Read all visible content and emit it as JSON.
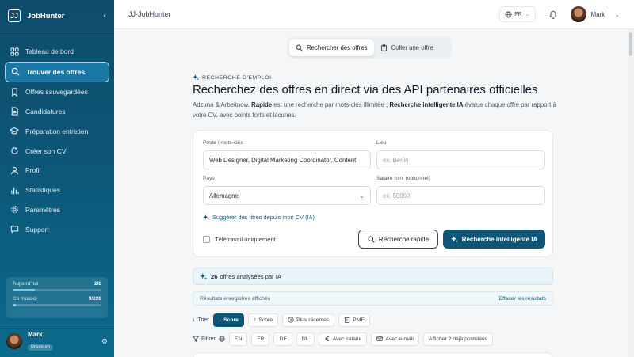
{
  "sidebar": {
    "brand": "JobHunter",
    "logo_glyph": "JJ",
    "items": [
      {
        "label": "Tableau de bord",
        "icon": "grid-icon"
      },
      {
        "label": "Trouver des offres",
        "icon": "search-icon",
        "active": true
      },
      {
        "label": "Offres sauvegardées",
        "icon": "bookmark-icon"
      },
      {
        "label": "Candidatures",
        "icon": "file-icon"
      },
      {
        "label": "Préparation entretien",
        "icon": "graduation-icon"
      },
      {
        "label": "Créer son CV",
        "icon": "refresh-icon"
      },
      {
        "label": "Profil",
        "icon": "user-icon"
      },
      {
        "label": "Statistiques",
        "icon": "bar-chart-icon"
      },
      {
        "label": "Paramètres",
        "icon": "gear-icon"
      },
      {
        "label": "Support",
        "icon": "chat-icon"
      }
    ],
    "quota": {
      "today_label": "Aujourd'hui",
      "today_value": "2/8",
      "today_fraction": 0.25,
      "month_label": "Ce mois-ci",
      "month_value": "9/220",
      "month_fraction": 0.04
    },
    "user": {
      "name": "Mark",
      "plan": "Premium"
    }
  },
  "topbar": {
    "title": "JJ-JobHunter",
    "language": "FR",
    "user_name": "Mark"
  },
  "tabs": [
    {
      "label": "Rechercher des offres",
      "active": true
    },
    {
      "label": "Coller une offre",
      "active": false
    }
  ],
  "search": {
    "kicker": "RECHERCHE D'EMPLOI",
    "headline": "Recherchez des offres en direct via des API partenaires officielles",
    "lead_part1": "Adzuna & Arbeitnow. ",
    "lead_bold1": "Rapide",
    "lead_part2": " est une recherche par mots-clés illimitée ; ",
    "lead_bold2": "Recherche intelligente IA",
    "lead_part3": " évalue chaque offre par rapport à votre CV, avec points forts et lacunes.",
    "keywords_label": "Poste / mots-clés",
    "keywords_value": "Web Designer, Digital Marketing Coordinator, Content",
    "location_label": "Lieu",
    "location_placeholder": "ex. Berlin",
    "country_label": "Pays",
    "country_value": "Allemagne",
    "salary_label": "Salaire min. (optionnel)",
    "salary_placeholder": "ex. 50000",
    "suggest_label": "Suggérer des titres depuis mon CV (IA)",
    "remote_label": "Télétravail uniquement",
    "quick_button": "Recherche rapide",
    "ai_button": "Recherche intelligente IA"
  },
  "results": {
    "count": "26",
    "count_suffix": "offres analysées par IA",
    "saved_notice": "Résultats enregistrés affichés",
    "clear_label": "Effacer les résultats",
    "sort_label": "Trier",
    "sort_options": [
      "Score",
      "Score",
      "Plus récentes",
      "PME"
    ],
    "filter_label": "Filtrer",
    "filter_options": [
      "EN",
      "FR",
      "DE",
      "NL",
      "Avec salaire",
      "Avec e-mail",
      "Afficher 2 déjà postulées"
    ]
  },
  "colors": {
    "primary": "#0d5677",
    "accent_light": "#e9f3fa",
    "sidebar": "#0f4c6b"
  }
}
